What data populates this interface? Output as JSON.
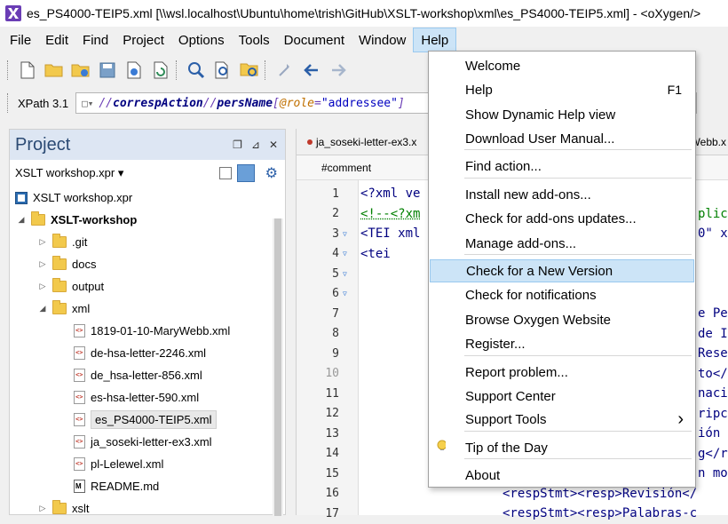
{
  "window": {
    "title": "es_PS4000-TEIP5.xml [\\\\wsl.localhost\\Ubuntu\\home\\trish\\GitHub\\XSLT-workshop\\xml\\es_PS4000-TEIP5.xml] - <oXygen/>"
  },
  "menubar": {
    "items": [
      "File",
      "Edit",
      "Find",
      "Project",
      "Options",
      "Tools",
      "Document",
      "Window",
      "Help"
    ],
    "active": "Help"
  },
  "xpath": {
    "version_label": "XPath 3.1",
    "expr_prefix": "//",
    "expr_step1": "correspAction",
    "expr_sep": "//",
    "expr_step2": "persName",
    "expr_open": "[",
    "expr_attr": "@role",
    "expr_eq": "=",
    "expr_value": "\"addressee\"",
    "expr_close": "]"
  },
  "project": {
    "title": "Project",
    "project_file": "XSLT workshop.xpr",
    "tree": [
      {
        "label": "XSLT workshop.xpr",
        "type": "xpr",
        "depth": 0,
        "twisty": ""
      },
      {
        "label": "XSLT-workshop",
        "type": "folder",
        "depth": 0,
        "twisty": "open",
        "bold": true
      },
      {
        "label": ".git",
        "type": "folder",
        "depth": 1,
        "twisty": "closed"
      },
      {
        "label": "docs",
        "type": "folder",
        "depth": 1,
        "twisty": "closed"
      },
      {
        "label": "output",
        "type": "folder",
        "depth": 1,
        "twisty": "closed"
      },
      {
        "label": "xml",
        "type": "folder",
        "depth": 1,
        "twisty": "open"
      },
      {
        "label": "1819-01-10-MaryWebb.xml",
        "type": "xml",
        "depth": 2
      },
      {
        "label": "de-hsa-letter-2246.xml",
        "type": "xml",
        "depth": 2
      },
      {
        "label": "de_hsa-letter-856.xml",
        "type": "xml",
        "depth": 2
      },
      {
        "label": "es-hsa-letter-590.xml",
        "type": "xml",
        "depth": 2
      },
      {
        "label": "es_PS4000-TEIP5.xml",
        "type": "xml",
        "depth": 2,
        "selected": true
      },
      {
        "label": "ja_soseki-letter-ex3.xml",
        "type": "xml",
        "depth": 2
      },
      {
        "label": "pl-Lelewel.xml",
        "type": "xml",
        "depth": 2
      },
      {
        "label": "README.md",
        "type": "md",
        "depth": 2
      },
      {
        "label": "xslt",
        "type": "folder",
        "depth": 1,
        "twisty": "closed"
      }
    ]
  },
  "editor": {
    "tab_label": "ja_soseki-letter-ex3.x",
    "tab_label_right": "Webb.x",
    "breadcrumb": "#comment",
    "lines": [
      {
        "no": "1",
        "text": "<?xml ve",
        "fold": false,
        "kind": "pi"
      },
      {
        "no": "2",
        "text": "<!--<?xm",
        "fold": false,
        "kind": "comment"
      },
      {
        "no": "3",
        "text": "<TEI xml",
        "fold": true,
        "kind": "tag"
      },
      {
        "no": "4",
        "text": "    <tei",
        "fold": true,
        "kind": "tag"
      },
      {
        "no": "5",
        "text": "",
        "fold": true,
        "kind": "tag"
      },
      {
        "no": "6",
        "text": "",
        "fold": true,
        "kind": "tag"
      },
      {
        "no": "7",
        "text": "",
        "fold": false,
        "kind": "tag"
      },
      {
        "no": "8",
        "text": "",
        "fold": false,
        "kind": "tag"
      },
      {
        "no": "9",
        "text": "",
        "fold": false,
        "kind": "tag"
      },
      {
        "no": "10",
        "text": "",
        "fold": false,
        "kind": "tag",
        "dim": true
      },
      {
        "no": "11",
        "text": "",
        "fold": false,
        "kind": "tag"
      },
      {
        "no": "12",
        "text": "",
        "fold": false,
        "kind": "tag"
      },
      {
        "no": "13",
        "text": "",
        "fold": false,
        "kind": "tag"
      },
      {
        "no": "14",
        "text": "",
        "fold": false,
        "kind": "tag"
      },
      {
        "no": "15",
        "text": "",
        "fold": false,
        "kind": "tag"
      },
      {
        "no": "16",
        "text": "",
        "fold": false,
        "kind": "tag"
      },
      {
        "no": "17",
        "text": "",
        "fold": false,
        "kind": "tag"
      }
    ],
    "right_fragments": [
      {
        "text": "plic",
        "kind": "comment"
      },
      {
        "text": "0\" x",
        "kind": "tag"
      },
      {
        "text": "e Pe",
        "kind": "tag"
      },
      {
        "text": "de I",
        "kind": "tag"
      },
      {
        "text": "Rese",
        "kind": "tag"
      },
      {
        "text": "to</",
        "kind": "tag"
      },
      {
        "text": "naci",
        "kind": "tag"
      },
      {
        "text": "ripc",
        "kind": "tag"
      },
      {
        "text": "ión",
        "kind": "tag"
      },
      {
        "text": "g</r",
        "kind": "tag"
      },
      {
        "text": "n mo",
        "kind": "tag"
      },
      {
        "text": "<respStmt><resp>Revisión</",
        "kind": "tag"
      },
      {
        "text": "<respStmt><resp>Palabras-c",
        "kind": "tag"
      }
    ]
  },
  "help_menu": {
    "items": [
      {
        "label": "Welcome",
        "shortcut": ""
      },
      {
        "label": "Help",
        "shortcut": "F1"
      },
      {
        "label": "Show Dynamic Help view",
        "shortcut": ""
      },
      {
        "label": "Download User Manual...",
        "shortcut": ""
      },
      {
        "label": "Find action...",
        "shortcut": ""
      },
      {
        "label": "Install new add-ons...",
        "shortcut": ""
      },
      {
        "label": "Check for add-ons updates...",
        "shortcut": ""
      },
      {
        "label": "Manage add-ons...",
        "shortcut": ""
      },
      {
        "label": "Check for a New Version",
        "shortcut": "",
        "highlighted": true
      },
      {
        "label": "Check for notifications",
        "shortcut": ""
      },
      {
        "label": "Browse Oxygen Website",
        "shortcut": ""
      },
      {
        "label": "Register...",
        "shortcut": ""
      },
      {
        "label": "Report problem...",
        "shortcut": ""
      },
      {
        "label": "Support Center",
        "shortcut": ""
      },
      {
        "label": "Support Tools",
        "shortcut": "",
        "submenu": true
      },
      {
        "label": "Tip of the Day",
        "shortcut": "",
        "icon": "lightbulb-icon"
      },
      {
        "label": "About",
        "shortcut": ""
      }
    ]
  },
  "colors": {
    "accent": "#cce4f7",
    "project_header": "#dde6f3",
    "folder": "#f2c94c"
  }
}
